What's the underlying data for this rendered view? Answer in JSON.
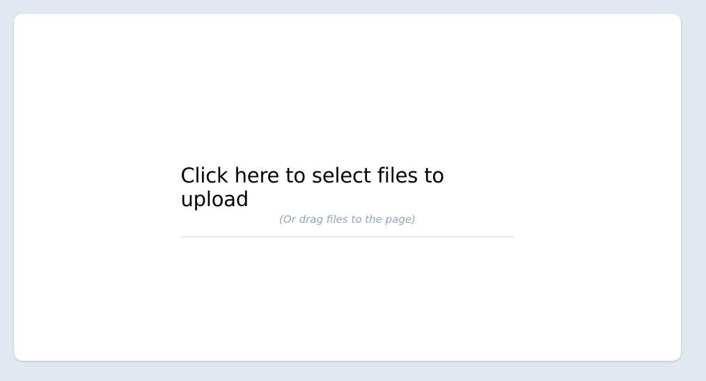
{
  "upload": {
    "title": "Click here to select files to upload",
    "subtitle": "(Or drag files to the page)"
  },
  "colors": {
    "background": "#e2e8f0",
    "card": "#ffffff",
    "title": "#000000",
    "subtitle": "#94a3b8",
    "divider": "#e2e8f0"
  }
}
